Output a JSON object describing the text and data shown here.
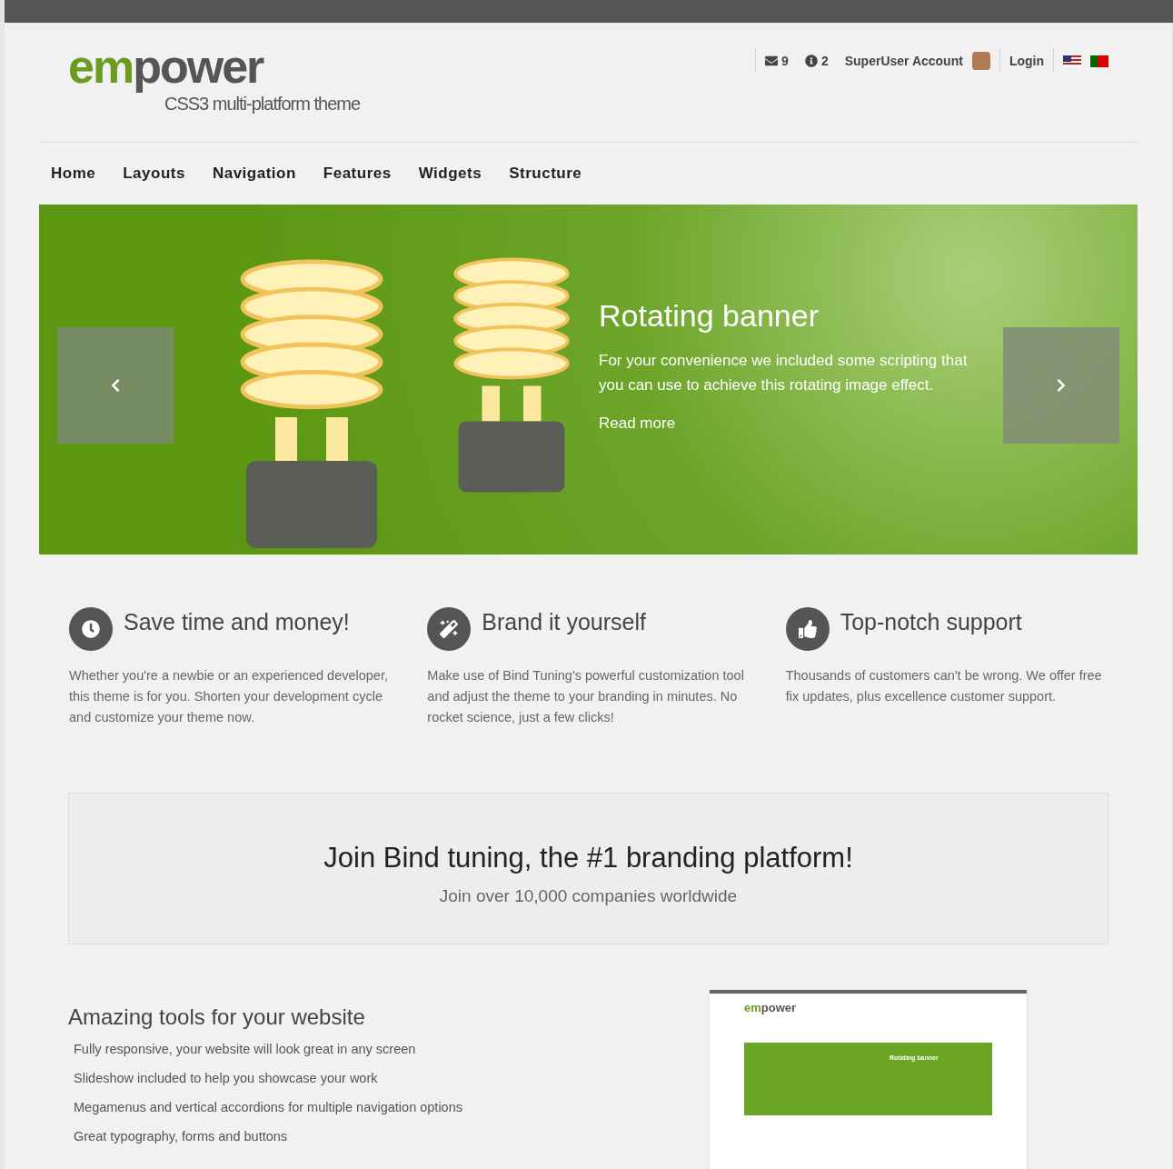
{
  "logo": {
    "brand_a": "em",
    "brand_b": "power",
    "tagline": "CSS3 multi-platform theme"
  },
  "topbar": {
    "messages": "9",
    "notifications": "2",
    "account": "SuperUser Account",
    "login": "Login"
  },
  "nav": [
    "Home",
    "Layouts",
    "Navigation",
    "Features",
    "Widgets",
    "Structure"
  ],
  "banner": {
    "title": "Rotating banner",
    "text": "For your convenience we included some scripting that you can use to achieve this rotating image effect.",
    "link": "Read more"
  },
  "features": [
    {
      "kind": "clock",
      "title": "Save time and money!",
      "text": "Whether you're a newbie or an experienced developer, this theme is for you. Shorten your development cycle and customize your theme now."
    },
    {
      "kind": "wand",
      "title": "Brand it yourself",
      "text": "Make use of Bind Tuning's powerful customization tool and adjust the theme to your branding in minutes. No rocket science, just a few clicks!"
    },
    {
      "kind": "thumb",
      "title": "Top-notch support",
      "text": "Thousands of customers can't be wrong. We offer free fix updates, plus excellence customer support."
    }
  ],
  "callout": {
    "title": "Join Bind tuning, the #1 branding platform!",
    "subtitle": "Join over 10,000 companies worldwide"
  },
  "tools": {
    "title": "Amazing tools for your website",
    "items": [
      "Fully responsive, your website will look great in any screen",
      "Slideshow included to help you showcase your work",
      "Megamenus and vertical accordions for multiple navigation options",
      "Great typography, forms and buttons"
    ]
  },
  "preview": {
    "brand_a": "em",
    "brand_b": "power",
    "banner_title": "Rotating banner"
  }
}
